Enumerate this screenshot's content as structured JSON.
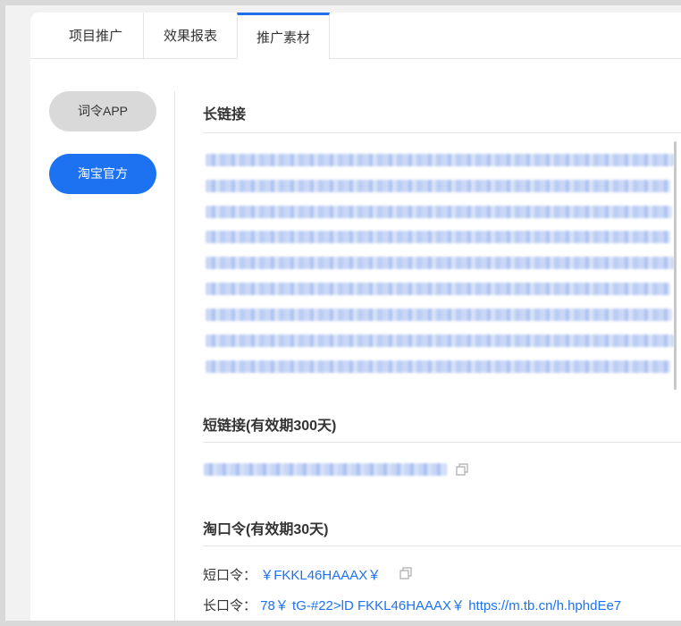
{
  "tabs": [
    {
      "label": "项目推广"
    },
    {
      "label": "效果报表"
    },
    {
      "label": "推广素材",
      "active": true
    }
  ],
  "sidebar": {
    "items": [
      {
        "label": "词令APP",
        "selected": false
      },
      {
        "label": "淘宝官方",
        "selected": true
      }
    ]
  },
  "sections": {
    "long_link": {
      "title": "长链接"
    },
    "short_link": {
      "title": "短链接(有效期300天)"
    },
    "tao_code": {
      "title": "淘口令(有效期30天)",
      "short_label": "短口令：",
      "short_value": "￥FKKL46HAAAX￥",
      "long_label": "长口令：",
      "long_value": "78￥ tG-#22>lD FKKL46HAAAX￥ https://m.tb.cn/h.hphdEe7"
    }
  },
  "colors": {
    "accent": "#1d72f2",
    "tab_active": "#1e6fe8"
  }
}
